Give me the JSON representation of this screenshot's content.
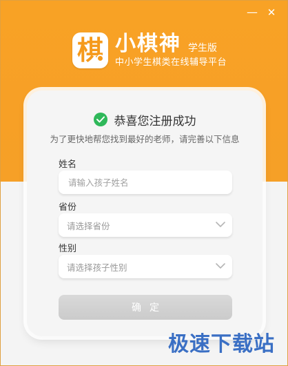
{
  "window": {
    "minimize_glyph": "—",
    "close_glyph": "✕"
  },
  "brand": {
    "logo_glyph": "棋",
    "name": "小棋神",
    "edition": "学生版",
    "slogan": "中小学生棋类在线辅导平台"
  },
  "form": {
    "success_message": "恭喜您注册成功",
    "info_message": "为了更快地帮您找到最好的老师，请完善以下信息",
    "name_label": "姓名",
    "name_placeholder": "请输入孩子姓名",
    "province_label": "省份",
    "province_placeholder": "请选择省份",
    "gender_label": "性别",
    "gender_placeholder": "请选择孩子性别",
    "submit_label": "确定"
  },
  "watermark": "极速下载站",
  "colors": {
    "accent": "#f7a126",
    "success": "#2fb85a",
    "watermark": "#3a6fc4"
  }
}
